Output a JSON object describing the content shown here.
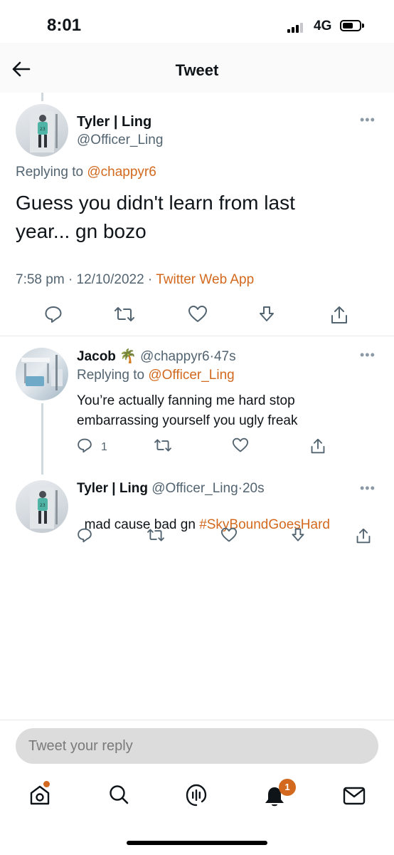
{
  "status_bar": {
    "time": "8:01",
    "network": "4G"
  },
  "header": {
    "title": "Tweet"
  },
  "main_tweet": {
    "name": "Tyler | Ling",
    "handle": "@Officer_Ling",
    "replying_prefix": "Replying to",
    "replying_to": "@chappyr6",
    "text_line1": "Guess you didn't learn from last",
    "text_line2": "year... gn bozo",
    "time": "7:58 pm",
    "date": "12/10/2022",
    "source": "Twitter Web App",
    "dot": "·"
  },
  "reply1": {
    "name": "Jacob",
    "emoji": "🌴",
    "handle": "@chappyr6",
    "age": "47s",
    "replying_prefix": "Replying to",
    "replying_to": "@Officer_Ling",
    "text_line1": "You’re actually fanning me hard stop",
    "text_line2": "embarrassing yourself you ugly freak",
    "reply_count": "1"
  },
  "reply2": {
    "name": "Tyler | Ling",
    "handle": "@Officer_Ling",
    "age": "20s",
    "text_plain": "mad cause bad gn ",
    "hashtag": "#SkyBoundGoesHard"
  },
  "composer": {
    "placeholder": "Tweet your reply"
  },
  "bottom_nav": {
    "notification_count": "1"
  },
  "colors": {
    "accent": "#d2691e",
    "text": "#0f1419",
    "muted": "#536471"
  }
}
